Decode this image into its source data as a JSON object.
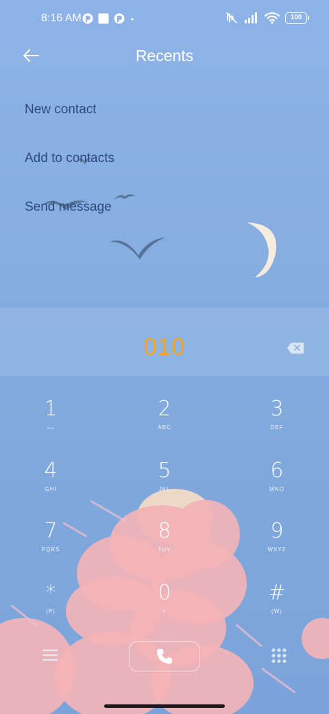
{
  "status_bar": {
    "time": "8:16 AM",
    "icons": [
      "notification-app-icon",
      "square-notification-icon",
      "notification-app-icon",
      "dot-icon",
      "mute-icon",
      "signal-icon",
      "wifi-icon"
    ],
    "battery": "100"
  },
  "header": {
    "title": "Recents",
    "back_icon": "arrow-left-icon"
  },
  "actions": [
    {
      "label": "New contact"
    },
    {
      "label": "Add to contacts"
    },
    {
      "label": "Send message"
    }
  ],
  "dialer": {
    "number": "010",
    "backspace_icon": "backspace-icon"
  },
  "keypad": [
    {
      "digit": "1",
      "letters": "ᴗᴗ"
    },
    {
      "digit": "2",
      "letters": "ABC"
    },
    {
      "digit": "3",
      "letters": "DEF"
    },
    {
      "digit": "4",
      "letters": "GHI"
    },
    {
      "digit": "5",
      "letters": "JKL"
    },
    {
      "digit": "6",
      "letters": "MNO"
    },
    {
      "digit": "7",
      "letters": "PQRS"
    },
    {
      "digit": "8",
      "letters": "TUV"
    },
    {
      "digit": "9",
      "letters": "WXYZ"
    },
    {
      "digit": "*",
      "letters": "(P)"
    },
    {
      "digit": "0",
      "letters": "+"
    },
    {
      "digit": "#",
      "letters": "(W)"
    }
  ],
  "bottom_bar": {
    "menu_icon": "menu-icon",
    "call_icon": "phone-icon",
    "dialpad_icon": "dialpad-icon"
  },
  "colors": {
    "background": "#86addf",
    "number": "#f2a31d",
    "action_text": "#2d4a78",
    "cloud": "#f3b3b6"
  }
}
